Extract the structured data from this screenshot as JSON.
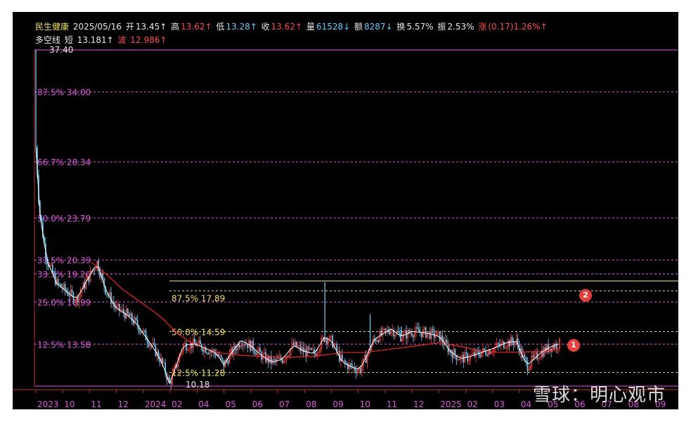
{
  "header": {
    "stock_name": "民生健康",
    "date": "2025/05/16",
    "open_label": "开",
    "open_value": "13.45↑",
    "high_label": "高",
    "high_value": "13.62↑",
    "low_label": "低",
    "low_value": "13.28↑",
    "close_label": "收",
    "close_value": "13.62↑",
    "volume_label": "量",
    "volume_value": "61528↓",
    "amount_label": "额",
    "amount_value": "8287↓",
    "turnover_label": "换",
    "turnover_value": "5.57%",
    "amplitude_label": "振",
    "amplitude_value": "2.53%",
    "change_label": "涨",
    "change_value": "(0.17)1.26%↑"
  },
  "indicator": {
    "name": "多空线",
    "short_label": "短",
    "short_value": "13.181↑",
    "wave_label": "波",
    "wave_value": "12.986↑"
  },
  "markers": [
    "1",
    "2"
  ],
  "watermark": "雪球：明心观市",
  "colors": {
    "up": "#ff3c3c",
    "down": "#6fd6ff",
    "ma_short": "#ffffff",
    "ma_long": "#ff2020",
    "fib_main": "#e055e0",
    "fib_sub": "#f0e14a"
  },
  "chart_data": {
    "type": "candlestick",
    "x_labels": [
      "2023",
      "10",
      "11",
      "12",
      "2024",
      "02",
      "04",
      "05",
      "06",
      "07",
      "08",
      "09",
      "10",
      "11",
      "12",
      "2025",
      "02",
      "03",
      "04",
      "05",
      "06",
      "07",
      "08",
      "09"
    ],
    "ylim": [
      10.18,
      37.4
    ],
    "max_price_label": "37.40",
    "fib_levels_main": [
      {
        "pct": "87.5%",
        "value": 34.0
      },
      {
        "pct": "66.7%",
        "value": 28.34
      },
      {
        "pct": "50.0%",
        "value": 23.79
      },
      {
        "pct": "37.5%",
        "value": 20.39
      },
      {
        "pct": "33.3%",
        "value": 19.26
      },
      {
        "pct": "25.0%",
        "value": 16.99
      },
      {
        "pct": "12.5%",
        "value": 13.58
      }
    ],
    "min_price_label": "10.18",
    "fib_levels_sub": [
      {
        "pct": "87.5%",
        "value": 17.89
      },
      {
        "pct": "50.0%",
        "value": 14.59
      },
      {
        "pct": "12.5%",
        "value": 11.28
      }
    ],
    "sub_range_top": 18.69,
    "price_path": [
      [
        0,
        29.5
      ],
      [
        5,
        24.5
      ],
      [
        15,
        20.5
      ],
      [
        30,
        18.5
      ],
      [
        45,
        17.8
      ],
      [
        58,
        17.2
      ],
      [
        72,
        18.6
      ],
      [
        88,
        20.2
      ],
      [
        100,
        18.0
      ],
      [
        115,
        16.5
      ],
      [
        130,
        16.0
      ],
      [
        145,
        15.2
      ],
      [
        160,
        14.0
      ],
      [
        172,
        13.0
      ],
      [
        182,
        12.0
      ],
      [
        188,
        11.0
      ],
      [
        192,
        10.4
      ],
      [
        200,
        11.6
      ],
      [
        212,
        13.5
      ],
      [
        230,
        13.6
      ],
      [
        245,
        13.2
      ],
      [
        260,
        12.8
      ],
      [
        270,
        11.9
      ],
      [
        280,
        12.8
      ],
      [
        295,
        13.9
      ],
      [
        310,
        13.4
      ],
      [
        325,
        12.6
      ],
      [
        340,
        12.1
      ],
      [
        355,
        12.4
      ],
      [
        370,
        13.5
      ],
      [
        385,
        13.0
      ],
      [
        400,
        12.8
      ],
      [
        415,
        14.2
      ],
      [
        425,
        13.8
      ],
      [
        440,
        12.1
      ],
      [
        455,
        11.7
      ],
      [
        465,
        11.5
      ],
      [
        475,
        12.6
      ],
      [
        485,
        13.9
      ],
      [
        495,
        14.3
      ],
      [
        510,
        14.8
      ],
      [
        525,
        14.2
      ],
      [
        540,
        14.6
      ],
      [
        560,
        14.5
      ],
      [
        580,
        14.2
      ],
      [
        595,
        13.0
      ],
      [
        610,
        12.4
      ],
      [
        625,
        12.6
      ],
      [
        640,
        12.9
      ],
      [
        660,
        13.3
      ],
      [
        675,
        13.7
      ],
      [
        690,
        13.8
      ],
      [
        705,
        11.8
      ],
      [
        712,
        12.2
      ],
      [
        725,
        12.9
      ],
      [
        740,
        13.4
      ],
      [
        752,
        13.62
      ]
    ],
    "ma_long_path": [
      [
        80,
        20.2
      ],
      [
        100,
        19.3
      ],
      [
        125,
        18.0
      ],
      [
        150,
        17.0
      ],
      [
        170,
        16.2
      ],
      [
        185,
        15.5
      ],
      [
        200,
        14.6
      ],
      [
        220,
        13.8
      ],
      [
        240,
        13.3
      ],
      [
        260,
        12.9
      ],
      [
        290,
        12.7
      ],
      [
        320,
        12.6
      ],
      [
        360,
        12.5
      ],
      [
        400,
        12.6
      ],
      [
        440,
        12.9
      ],
      [
        470,
        12.9
      ],
      [
        500,
        13.1
      ],
      [
        540,
        13.4
      ],
      [
        580,
        13.7
      ],
      [
        610,
        13.4
      ],
      [
        640,
        13.0
      ],
      [
        670,
        12.9
      ],
      [
        700,
        12.95
      ],
      [
        730,
        13.0
      ],
      [
        752,
        13.2
      ]
    ],
    "spikes": [
      {
        "index": 415,
        "high": 18.6
      },
      {
        "index": 480,
        "high": 16.0
      },
      {
        "index": 525,
        "high": 15.0
      }
    ],
    "total_bars": 380
  }
}
